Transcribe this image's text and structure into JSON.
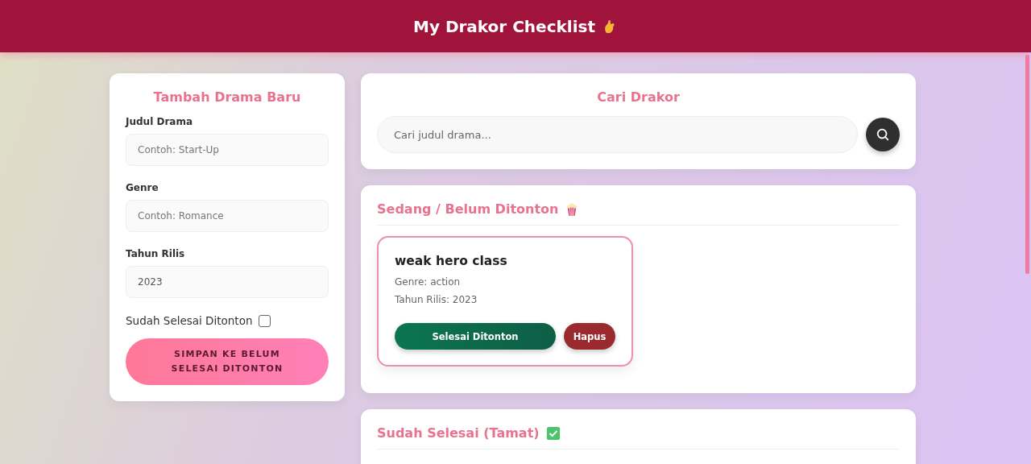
{
  "header": {
    "title": "My Drakor Checklist"
  },
  "add_form": {
    "title": "Tambah Drama Baru",
    "fields": [
      {
        "label": "Judul Drama",
        "placeholder": "Contoh: Start-Up"
      },
      {
        "label": "Genre",
        "placeholder": "Contoh: Romance"
      },
      {
        "label": "Tahun Rilis",
        "value": "2023"
      }
    ],
    "finished_checkbox": {
      "label": "Sudah Selesai Ditonton",
      "checked": false
    },
    "submit_button": "SIMPAN KE BELUM SELESAI DITONTON"
  },
  "search": {
    "title": "Cari Drakor",
    "placeholder": "Cari judul drama..."
  },
  "sections": [
    {
      "title": "Sedang / Belum Ditonton",
      "kind": "watching",
      "items": [
        {
          "title": "weak hero class",
          "genre": "Genre: action",
          "year": "Tahun Rilis: 2023",
          "done_button": "Selesai Ditonton",
          "delete_button": "Hapus"
        }
      ]
    },
    {
      "title": "Sudah Selesai (Tamat)",
      "kind": "finished"
    }
  ]
}
